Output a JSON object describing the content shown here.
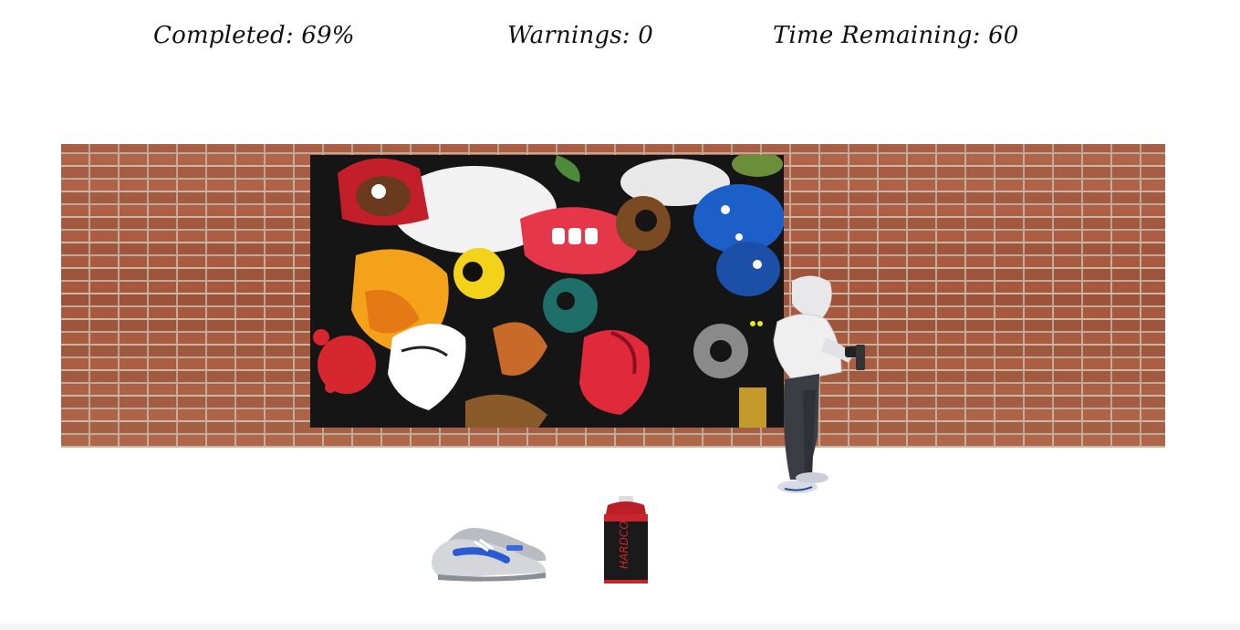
{
  "hud": {
    "completed_text": "Completed: 69%",
    "warnings_text": "Warnings: 0",
    "time_text": "Time Remaining: 60"
  },
  "game": {
    "completed_percent": 69,
    "warnings": 0,
    "time_remaining": 60
  },
  "scene": {
    "wall_color": "#a85a3e",
    "mural_colors": [
      "#e0323c",
      "#1d5fc9",
      "#f4a81a",
      "#ffffff",
      "#2b2b2b",
      "#6a8e3a"
    ],
    "spraycan_color": "#c8242b"
  },
  "icons": {
    "sneaker": "sneaker-icon",
    "spraycan": "spray-can-icon",
    "person": "sprayer-person-icon"
  }
}
